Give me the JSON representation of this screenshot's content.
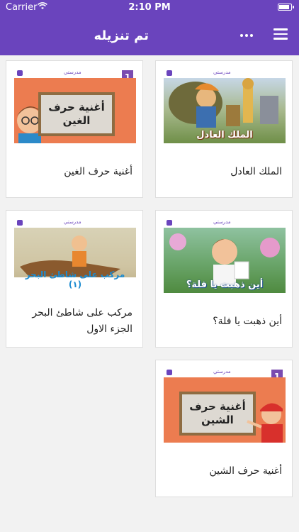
{
  "status_bar": {
    "carrier": "Carrier",
    "time": "2:10 PM"
  },
  "header": {
    "title": "تم تنزيله"
  },
  "grid": {
    "items": [
      {
        "caption": "الملك العادل",
        "thumb_title": "الملك العادل"
      },
      {
        "caption": "أغنية حرف الغين",
        "thumb_title": "أغنية حرف الغين",
        "grade": "1"
      },
      {
        "caption": "أين ذهبت يا فلة؟",
        "thumb_title": "أين ذهبت يا فلة؟"
      },
      {
        "caption": "مركب على شاطئ البحر الجزء الاول",
        "thumb_title": "مركب على شاطئ البحر (١)"
      },
      {
        "caption": "أغنية حرف الشين",
        "thumb_title": "أغنية حرف الشين",
        "grade": "1"
      }
    ]
  },
  "brand": "مدرستي",
  "colors": {
    "header": "#6a44bd",
    "background": "#f2f2f2",
    "accent_orange": "#ec7c50"
  }
}
